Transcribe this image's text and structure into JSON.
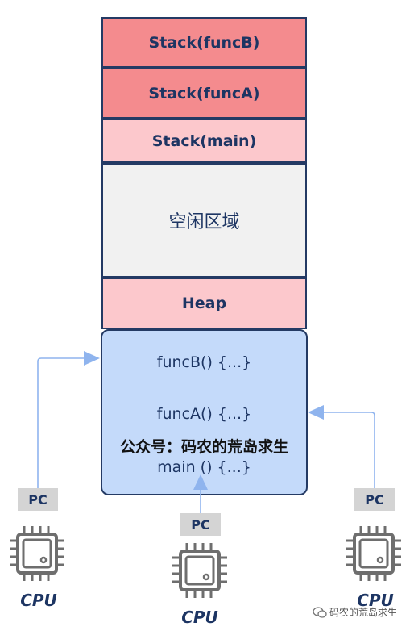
{
  "memory": {
    "stack_funcB": "Stack(funcB)",
    "stack_funcA": "Stack(funcA)",
    "stack_main": "Stack(main)",
    "free_area": "空闲区域",
    "heap": "Heap",
    "code": {
      "funcB": "funcB() {...}",
      "funcA": "funcA() {...}",
      "main": "main () {...}"
    }
  },
  "watermark": "公众号：码农的荒岛求生",
  "cpus": [
    {
      "pc_label": "PC",
      "cpu_label": "CPU"
    },
    {
      "pc_label": "PC",
      "cpu_label": "CPU"
    },
    {
      "pc_label": "PC",
      "cpu_label": "CPU"
    }
  ],
  "credit": "码农的荒岛求生",
  "colors": {
    "stack_active": "#f48b8e",
    "stack_light": "#fcc8cc",
    "free": "#f1f1f1",
    "code": "#c4dafa",
    "border": "#243a64",
    "arrow": "#8fb4ee"
  }
}
